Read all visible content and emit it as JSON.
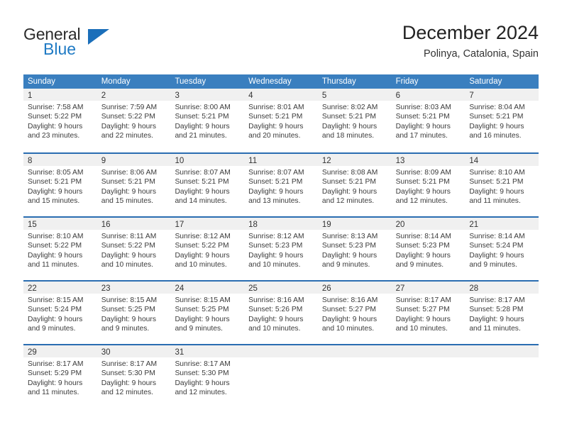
{
  "brand": {
    "name_top": "General",
    "name_bottom": "Blue",
    "accent_color": "#1b6fba",
    "triangle_icon": "triangle-icon"
  },
  "header": {
    "title": "December 2024",
    "subtitle": "Polinya, Catalonia, Spain"
  },
  "calendar": {
    "header_bg": "#3a7fbf",
    "row_separator_color": "#2a6db1",
    "day_band_bg": "#f0f0f0",
    "weekdays": [
      "Sunday",
      "Monday",
      "Tuesday",
      "Wednesday",
      "Thursday",
      "Friday",
      "Saturday"
    ],
    "weeks": [
      {
        "days": [
          {
            "number": "1",
            "sunrise": "Sunrise: 7:58 AM",
            "sunset": "Sunset: 5:22 PM",
            "daylight_1": "Daylight: 9 hours",
            "daylight_2": "and 23 minutes."
          },
          {
            "number": "2",
            "sunrise": "Sunrise: 7:59 AM",
            "sunset": "Sunset: 5:22 PM",
            "daylight_1": "Daylight: 9 hours",
            "daylight_2": "and 22 minutes."
          },
          {
            "number": "3",
            "sunrise": "Sunrise: 8:00 AM",
            "sunset": "Sunset: 5:21 PM",
            "daylight_1": "Daylight: 9 hours",
            "daylight_2": "and 21 minutes."
          },
          {
            "number": "4",
            "sunrise": "Sunrise: 8:01 AM",
            "sunset": "Sunset: 5:21 PM",
            "daylight_1": "Daylight: 9 hours",
            "daylight_2": "and 20 minutes."
          },
          {
            "number": "5",
            "sunrise": "Sunrise: 8:02 AM",
            "sunset": "Sunset: 5:21 PM",
            "daylight_1": "Daylight: 9 hours",
            "daylight_2": "and 18 minutes."
          },
          {
            "number": "6",
            "sunrise": "Sunrise: 8:03 AM",
            "sunset": "Sunset: 5:21 PM",
            "daylight_1": "Daylight: 9 hours",
            "daylight_2": "and 17 minutes."
          },
          {
            "number": "7",
            "sunrise": "Sunrise: 8:04 AM",
            "sunset": "Sunset: 5:21 PM",
            "daylight_1": "Daylight: 9 hours",
            "daylight_2": "and 16 minutes."
          }
        ]
      },
      {
        "days": [
          {
            "number": "8",
            "sunrise": "Sunrise: 8:05 AM",
            "sunset": "Sunset: 5:21 PM",
            "daylight_1": "Daylight: 9 hours",
            "daylight_2": "and 15 minutes."
          },
          {
            "number": "9",
            "sunrise": "Sunrise: 8:06 AM",
            "sunset": "Sunset: 5:21 PM",
            "daylight_1": "Daylight: 9 hours",
            "daylight_2": "and 15 minutes."
          },
          {
            "number": "10",
            "sunrise": "Sunrise: 8:07 AM",
            "sunset": "Sunset: 5:21 PM",
            "daylight_1": "Daylight: 9 hours",
            "daylight_2": "and 14 minutes."
          },
          {
            "number": "11",
            "sunrise": "Sunrise: 8:07 AM",
            "sunset": "Sunset: 5:21 PM",
            "daylight_1": "Daylight: 9 hours",
            "daylight_2": "and 13 minutes."
          },
          {
            "number": "12",
            "sunrise": "Sunrise: 8:08 AM",
            "sunset": "Sunset: 5:21 PM",
            "daylight_1": "Daylight: 9 hours",
            "daylight_2": "and 12 minutes."
          },
          {
            "number": "13",
            "sunrise": "Sunrise: 8:09 AM",
            "sunset": "Sunset: 5:21 PM",
            "daylight_1": "Daylight: 9 hours",
            "daylight_2": "and 12 minutes."
          },
          {
            "number": "14",
            "sunrise": "Sunrise: 8:10 AM",
            "sunset": "Sunset: 5:21 PM",
            "daylight_1": "Daylight: 9 hours",
            "daylight_2": "and 11 minutes."
          }
        ]
      },
      {
        "days": [
          {
            "number": "15",
            "sunrise": "Sunrise: 8:10 AM",
            "sunset": "Sunset: 5:22 PM",
            "daylight_1": "Daylight: 9 hours",
            "daylight_2": "and 11 minutes."
          },
          {
            "number": "16",
            "sunrise": "Sunrise: 8:11 AM",
            "sunset": "Sunset: 5:22 PM",
            "daylight_1": "Daylight: 9 hours",
            "daylight_2": "and 10 minutes."
          },
          {
            "number": "17",
            "sunrise": "Sunrise: 8:12 AM",
            "sunset": "Sunset: 5:22 PM",
            "daylight_1": "Daylight: 9 hours",
            "daylight_2": "and 10 minutes."
          },
          {
            "number": "18",
            "sunrise": "Sunrise: 8:12 AM",
            "sunset": "Sunset: 5:23 PM",
            "daylight_1": "Daylight: 9 hours",
            "daylight_2": "and 10 minutes."
          },
          {
            "number": "19",
            "sunrise": "Sunrise: 8:13 AM",
            "sunset": "Sunset: 5:23 PM",
            "daylight_1": "Daylight: 9 hours",
            "daylight_2": "and 9 minutes."
          },
          {
            "number": "20",
            "sunrise": "Sunrise: 8:14 AM",
            "sunset": "Sunset: 5:23 PM",
            "daylight_1": "Daylight: 9 hours",
            "daylight_2": "and 9 minutes."
          },
          {
            "number": "21",
            "sunrise": "Sunrise: 8:14 AM",
            "sunset": "Sunset: 5:24 PM",
            "daylight_1": "Daylight: 9 hours",
            "daylight_2": "and 9 minutes."
          }
        ]
      },
      {
        "days": [
          {
            "number": "22",
            "sunrise": "Sunrise: 8:15 AM",
            "sunset": "Sunset: 5:24 PM",
            "daylight_1": "Daylight: 9 hours",
            "daylight_2": "and 9 minutes."
          },
          {
            "number": "23",
            "sunrise": "Sunrise: 8:15 AM",
            "sunset": "Sunset: 5:25 PM",
            "daylight_1": "Daylight: 9 hours",
            "daylight_2": "and 9 minutes."
          },
          {
            "number": "24",
            "sunrise": "Sunrise: 8:15 AM",
            "sunset": "Sunset: 5:25 PM",
            "daylight_1": "Daylight: 9 hours",
            "daylight_2": "and 9 minutes."
          },
          {
            "number": "25",
            "sunrise": "Sunrise: 8:16 AM",
            "sunset": "Sunset: 5:26 PM",
            "daylight_1": "Daylight: 9 hours",
            "daylight_2": "and 10 minutes."
          },
          {
            "number": "26",
            "sunrise": "Sunrise: 8:16 AM",
            "sunset": "Sunset: 5:27 PM",
            "daylight_1": "Daylight: 9 hours",
            "daylight_2": "and 10 minutes."
          },
          {
            "number": "27",
            "sunrise": "Sunrise: 8:17 AM",
            "sunset": "Sunset: 5:27 PM",
            "daylight_1": "Daylight: 9 hours",
            "daylight_2": "and 10 minutes."
          },
          {
            "number": "28",
            "sunrise": "Sunrise: 8:17 AM",
            "sunset": "Sunset: 5:28 PM",
            "daylight_1": "Daylight: 9 hours",
            "daylight_2": "and 11 minutes."
          }
        ]
      },
      {
        "days": [
          {
            "number": "29",
            "sunrise": "Sunrise: 8:17 AM",
            "sunset": "Sunset: 5:29 PM",
            "daylight_1": "Daylight: 9 hours",
            "daylight_2": "and 11 minutes."
          },
          {
            "number": "30",
            "sunrise": "Sunrise: 8:17 AM",
            "sunset": "Sunset: 5:30 PM",
            "daylight_1": "Daylight: 9 hours",
            "daylight_2": "and 12 minutes."
          },
          {
            "number": "31",
            "sunrise": "Sunrise: 8:17 AM",
            "sunset": "Sunset: 5:30 PM",
            "daylight_1": "Daylight: 9 hours",
            "daylight_2": "and 12 minutes."
          },
          {
            "number": "",
            "sunrise": "",
            "sunset": "",
            "daylight_1": "",
            "daylight_2": ""
          },
          {
            "number": "",
            "sunrise": "",
            "sunset": "",
            "daylight_1": "",
            "daylight_2": ""
          },
          {
            "number": "",
            "sunrise": "",
            "sunset": "",
            "daylight_1": "",
            "daylight_2": ""
          },
          {
            "number": "",
            "sunrise": "",
            "sunset": "",
            "daylight_1": "",
            "daylight_2": ""
          }
        ]
      }
    ]
  }
}
